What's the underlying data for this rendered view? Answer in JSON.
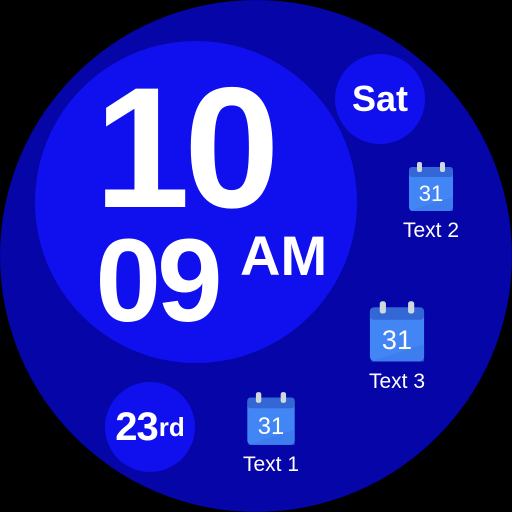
{
  "time": {
    "hour": "10",
    "minute": "09",
    "ampm": "AM"
  },
  "day": {
    "label": "Sat"
  },
  "date": {
    "number": "23",
    "suffix": "rd"
  },
  "complications": [
    {
      "icon": "calendar-icon",
      "icon_text": "31",
      "label": "Text 1"
    },
    {
      "icon": "calendar-icon",
      "icon_text": "31",
      "label": "Text 2"
    },
    {
      "icon": "calendar-icon",
      "icon_text": "31",
      "label": "Text 3"
    }
  ],
  "colors": {
    "background": "#0505a8",
    "accent_circle": "#1010ee",
    "calendar_blue": "#4285f4",
    "text": "#ffffff"
  }
}
